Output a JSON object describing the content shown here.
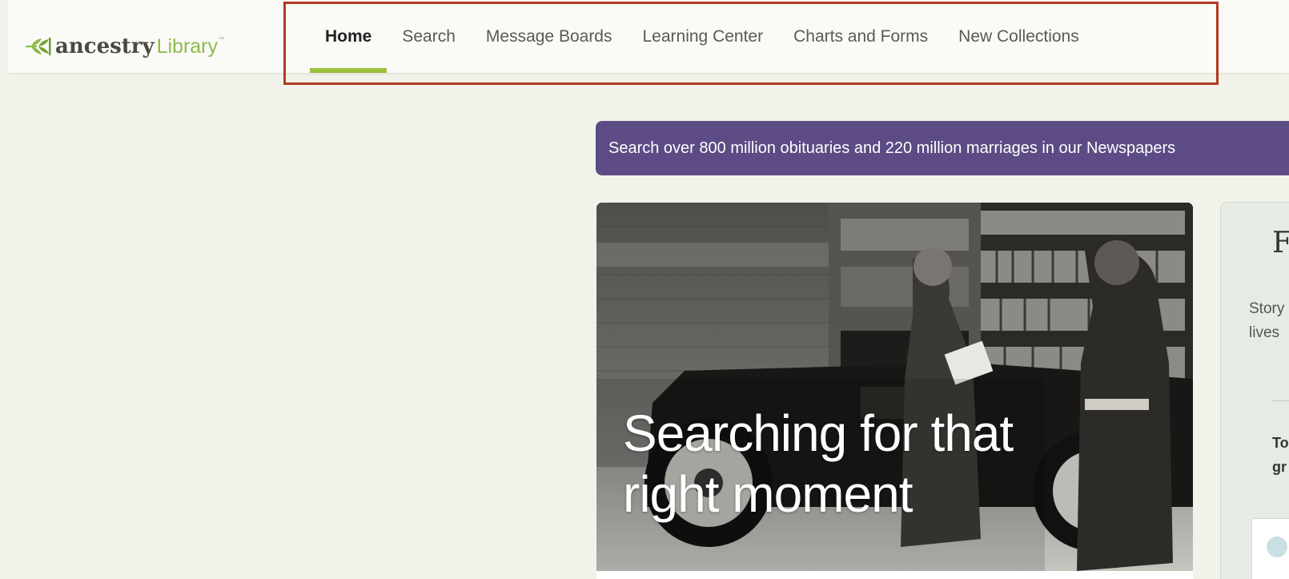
{
  "header": {
    "logo": {
      "word": "ancestry",
      "library": "Library",
      "tm": "™"
    },
    "nav": [
      {
        "label": "Home",
        "active": true
      },
      {
        "label": "Search",
        "active": false
      },
      {
        "label": "Message Boards",
        "active": false
      },
      {
        "label": "Learning Center",
        "active": false
      },
      {
        "label": "Charts and Forms",
        "active": false
      },
      {
        "label": "New Collections",
        "active": false
      }
    ]
  },
  "banner": {
    "text": "Search over 800 million obituaries and 220 million marriages in our Newspapers"
  },
  "hero": {
    "title_line1": "Searching for that",
    "title_line2": "right moment"
  },
  "side": {
    "heading": "F",
    "text_line1": "Story",
    "text_line2": "lives",
    "bold_line1": "To",
    "bold_line2": "gr"
  },
  "colors": {
    "accent_green": "#9bc13c",
    "banner_purple": "#5c4b84",
    "highlight_red": "#b03a22"
  }
}
